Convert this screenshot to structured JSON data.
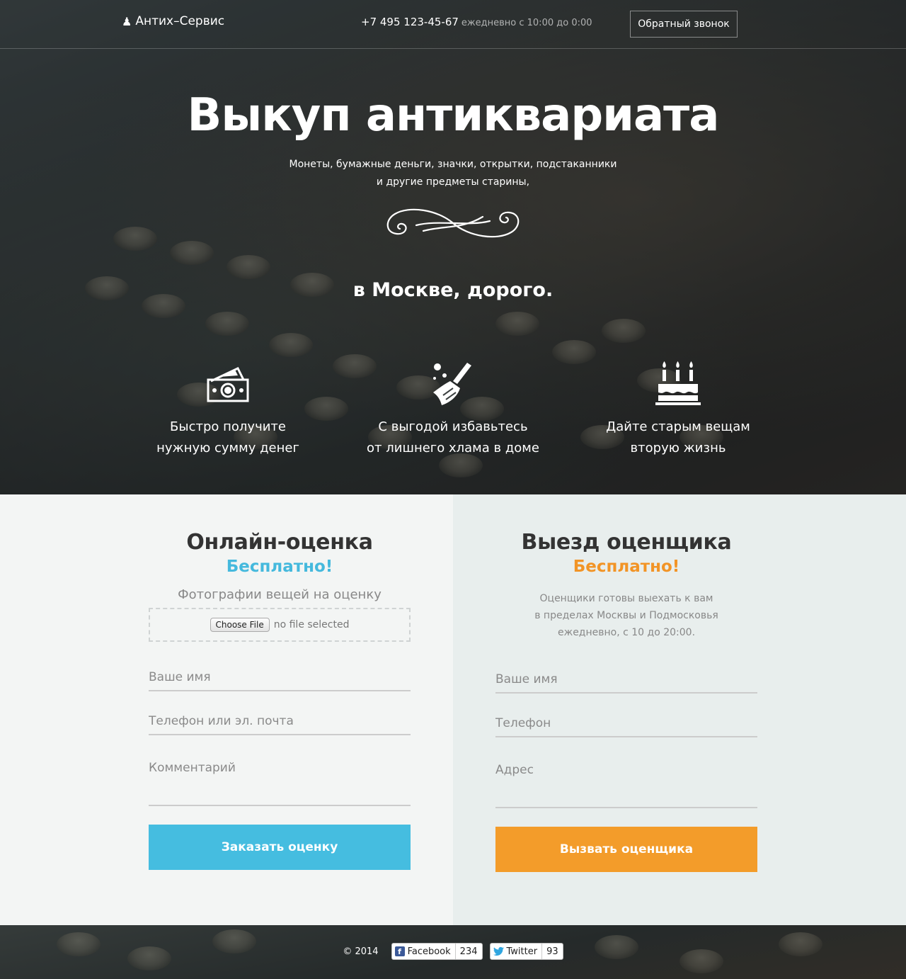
{
  "header": {
    "logo_text": "Антих–Сервис",
    "logo_icon": "chess-pawn-icon",
    "phone": "+7 495 123-45-67",
    "hours": "ежедневно с 10:00 до 0:00",
    "callback_label": "Обратный звонок"
  },
  "hero": {
    "title": "Выкуп антиквариата",
    "subtitle_line1": "Монеты, бумажные деньги, значки, открытки, подстаканники",
    "subtitle_line2": "и другие предметы старины,",
    "city": "в Москве, дорого.",
    "features": [
      {
        "icon": "money-icon",
        "line1": "Быстро получите",
        "line2": "нужную сумму денег"
      },
      {
        "icon": "broom-icon",
        "line1": "С выгодой избавьтесь",
        "line2": "от лишнего хлама в доме"
      },
      {
        "icon": "birthday-cake-icon",
        "line1": "Дайте старым вещам",
        "line2": "вторую жизнь"
      }
    ]
  },
  "online_form": {
    "title": "Онлайн-оценка",
    "free": "Бесплатно!",
    "photos_label": "Фотографии вещей на оценку",
    "file_button": "Choose File",
    "file_status": "no file selected",
    "name_placeholder": "Ваше имя",
    "contact_placeholder": "Телефон или эл. почта",
    "comment_placeholder": "Комментарий",
    "submit_label": "Заказать оценку",
    "accent": "#45bde0"
  },
  "visit_form": {
    "title": "Выезд оценщика",
    "free": "Бесплатно!",
    "note_line1": "Оценщики готовы выехать к вам",
    "note_line2": "в пределах Москвы и Подмосковья",
    "note_line3": "ежедневно, с 10 до 20:00.",
    "name_placeholder": "Ваше имя",
    "phone_placeholder": "Телефон",
    "address_placeholder": "Адрес",
    "submit_label": "Вызвать оценщика",
    "accent": "#f39c2a"
  },
  "footer": {
    "copyright": "© 2014",
    "facebook_label": "Facebook",
    "facebook_count": "234",
    "twitter_label": "Twitter",
    "twitter_count": "93"
  }
}
